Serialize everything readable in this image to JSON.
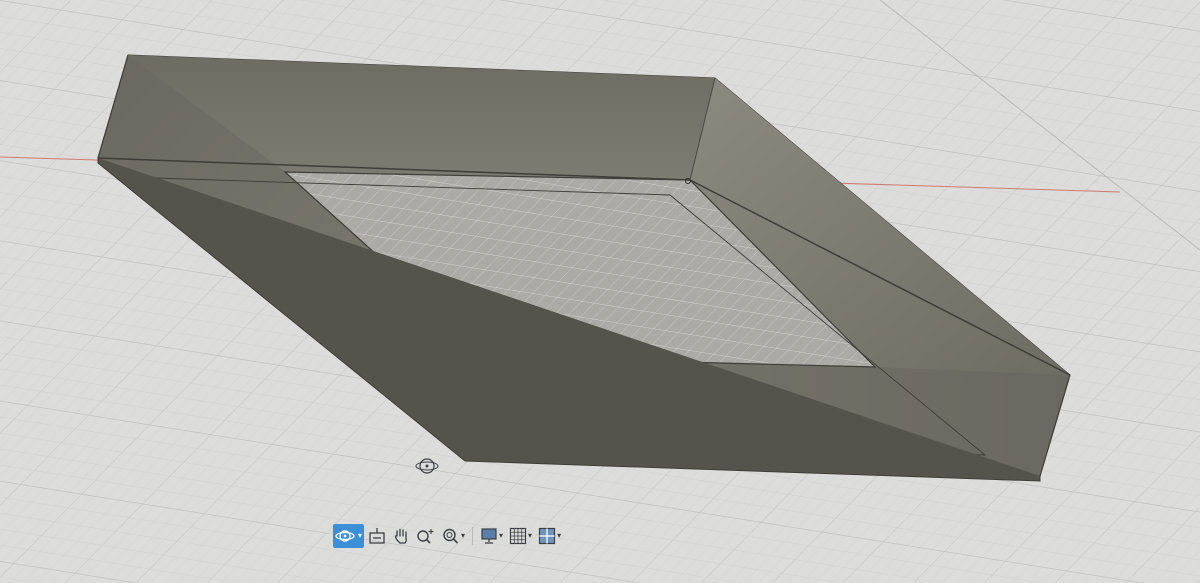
{
  "colors": {
    "background": "#dcdcda",
    "grid_minor": "#cfcfcd",
    "grid_major": "#c2c2c0",
    "axis_red": "#d07a72",
    "body_top": "#7c7b71",
    "body_dark": "#5c5b53",
    "body_light": "#8a897f",
    "edge": "#3e3d38",
    "nav_active": "#3a8fd6"
  },
  "viewport": {
    "axis_tick_labels": [
      "",
      ""
    ]
  },
  "navigation_bar": {
    "tools": [
      {
        "name": "orbit-tool",
        "icon": "orbit-icon",
        "active": true,
        "has_dropdown": true
      },
      {
        "name": "look-at-tool",
        "icon": "look-at-icon",
        "active": false,
        "has_dropdown": false
      },
      {
        "name": "pan-tool",
        "icon": "pan-hand-icon",
        "active": false,
        "has_dropdown": false
      },
      {
        "name": "zoom-tool",
        "icon": "zoom-icon",
        "active": false,
        "has_dropdown": false
      },
      {
        "name": "fit-tool",
        "icon": "fit-zoom-icon",
        "active": false,
        "has_dropdown": true
      },
      {
        "name": "display-settings",
        "icon": "display-icon",
        "active": false,
        "has_dropdown": true
      },
      {
        "name": "grid-settings",
        "icon": "grid-icon",
        "active": false,
        "has_dropdown": true
      },
      {
        "name": "viewports",
        "icon": "viewports-icon",
        "active": false,
        "has_dropdown": true
      }
    ]
  }
}
